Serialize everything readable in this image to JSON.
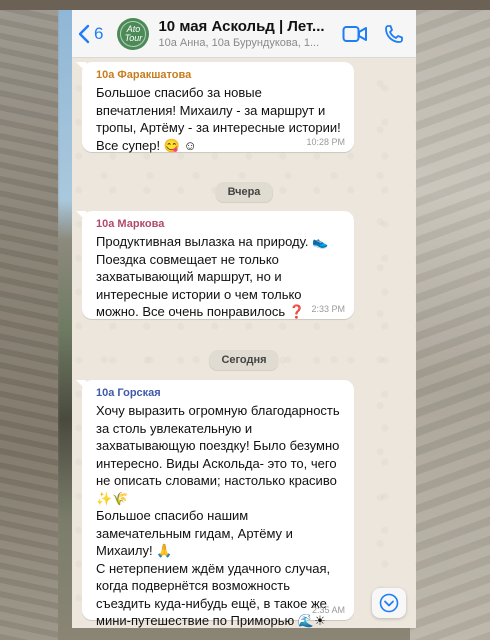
{
  "header": {
    "back_count": "6",
    "avatar_text": "Ato Tour",
    "title": "10 мая Аскольд | Лет...",
    "subtitle": "10а Анна, 10а Бурундукова, 1..."
  },
  "messages": [
    {
      "sender": "10а Фаракшатова",
      "sender_color": "#c77d1e",
      "text": "Большое спасибо за новые впечатления! Михаилу - за маршрут и тропы, Артёму - за интересные истории! Все супер! 😋 ☺",
      "time": "10:28 PM"
    },
    {
      "sender": "10а Маркова",
      "sender_color": "#b14a6e",
      "text": "Продуктивная вылазка на природу. 👟 Поездка совмещает не только захватывающий маршрут, но и интересные истории о чем только можно. Все очень понравилось ❓",
      "time": "2:33 PM"
    },
    {
      "sender": "10а Горская",
      "sender_color": "#3f5aa8",
      "text": "Хочу выразить огромную благодарность за столь увлекательную и захватывающую поездку! Было безумно интересно. Виды Аскольда- это то, чего не описать словами; настолько красиво ✨🌾\nБольшое спасибо нашим замечательным гидам, Артёму и Михаилу! 🙏\nС нетерпением ждём удачного случая, когда подвернётся возможность съездить куда-нибудь ещё, в такое же мини-путешествие по Приморью 🌊☀",
      "time": "2:35 AM"
    }
  ],
  "dates": {
    "yesterday": "Вчера",
    "today": "Сегодня"
  },
  "icons": {
    "back": "chevron-left-icon",
    "video": "video-camera-icon",
    "call": "phone-icon",
    "scroll_down": "chevron-down-circle-icon"
  },
  "colors": {
    "accent": "#1f7ef5",
    "chat_bg": "#ece6dc",
    "bubble": "#ffffff"
  }
}
